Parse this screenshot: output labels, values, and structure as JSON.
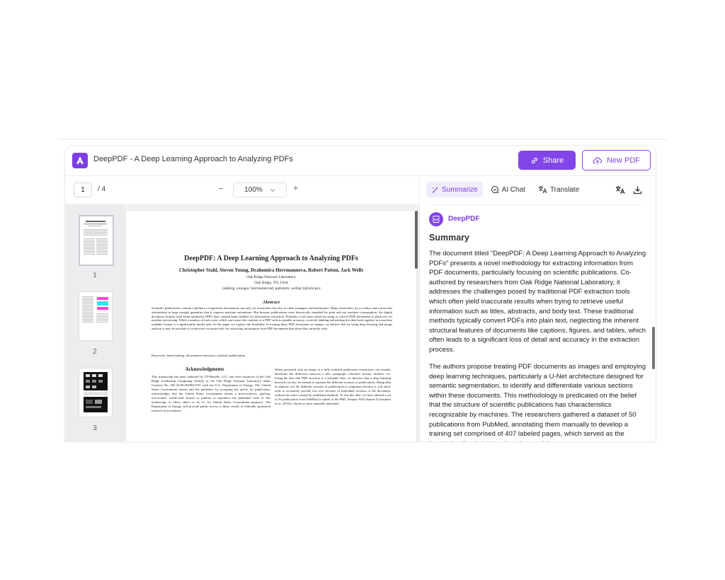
{
  "header": {
    "title": "DeepPDF - A Deep Learning Approach to Analyzing PDFs",
    "share_label": "Share",
    "new_pdf_label": "New PDF"
  },
  "viewer": {
    "current_page": "1",
    "total_pages": "/ 4",
    "zoom": "100%",
    "thumbnails": [
      "1",
      "2",
      "3"
    ]
  },
  "paper": {
    "title": "DeepPDF: A Deep Learning Approach to Analyzing PDFs",
    "authors": "Christopher Stahl, Steven Young, Drahomira Herrmannova, Robert Patton, Jack Wells",
    "affil1": "Oak Ridge National Laboratory",
    "affil2": "Oak Ridge, TN, USA",
    "emails": "{stahlcg, youngsr, herrmannovad, pattonrm, wellsjc}@ornl.gov",
    "abstract_heading": "Abstract",
    "abstract": "Scientific publications contain a plethora of important information, not only for researchers but also for their managers and institutions. Many researchers try to collect and extract this information in large enough quantities that it requires machine automation. But because publications were historically intended for print and not machine consumption, the digital document formats used today (primarily PDF) have created many hurdles for information extraction. Primarily, tools have relied on trying to convert PDF documents to plain text for machine processing. While a number of tools exist, which can extract the contents of a PDF with acceptable accuracy, correctly labeling and piecing this data back together in a machine readable format is a significantly harder task. In this paper we explore the feasibility of treating these PDF documents as images, we believe that by using deep learning and image analysis it may be possible to create more accurate tools for extracting information from PDF documents than those that currently exist.",
    "keywords": "Keywords: deep learning, information extraction, scholarly publications",
    "ack_heading": "Acknowledgments",
    "col1": "This manuscript has been authored by UT-Battelle, LLC and used resources of the Oak Ridge Leadership Computing Facility at the Oak Ridge National Laboratory under Contract No. DE-AC05-00OR22725 with the U.S. Department of Energy. The United States Government retains and the publisher, by accepting the article for publication, acknowledges that the United States Government retains a non-exclusive, paid-up, irrevocable, world-wide license to publish or reproduce the published form of this manuscript, or allow others to do so, for United States Government purposes. The Department of Energy will provide public access to these results of federally sponsored research in accordance",
    "col2": "When presented with an image of a fully redacted publication researchers can visually determine the difference between a title, paragraph, reference section, headers, etc. Using the idea that PDF structure is a trainable idea, we theorize that a deep learning network can also be trained to separate the different sections of publications. Being able to separate out the different sections of publications is important because it will allow tools to accurately provide raw text versions of individual sections of the document, without the noise created by traditional methods. To test this idea, we have utilized a set of 50 publications from PubMed (a subset of the PMC Sample 1943 dataset (Constantin et al., 2013)), which we have manually annotated"
  },
  "panel": {
    "tabs": [
      {
        "label": "Summarize",
        "icon": "sparkle-wand-icon",
        "active": true
      },
      {
        "label": "AI Chat",
        "icon": "chat-bubble-icon",
        "active": false
      },
      {
        "label": "Translate",
        "icon": "translate-icon",
        "active": false
      }
    ],
    "brand": "DeepPDF",
    "summary_heading": "Summary",
    "paragraph1": "The document titled “DeepPDF: A Deep Learning Approach to Analyzing PDFs” presents a novel methodology for extracting information from PDF documents, particularly focusing on scientific publications. Co-authored by researchers from Oak Ridge National Laboratory, it addresses the challenges posed by traditional PDF extraction tools which often yield inaccurate results when trying to retrieve useful information such as titles, abstracts, and body text. These traditional methods typically convert PDFs into plain text, neglecting the inherent structural features of documents like captions, figures, and tables, which often leads to a significant loss of detail and accuracy in the extraction process.",
    "paragraph2": "The authors propose treating PDF documents as images and employing deep learning techniques, particularly a U-Net architecture designed for semantic segmentation, to identify and differentiate various sections within these documents. This methodology is predicated on the belief that the structure of scientific publications has characteristics recognizable by machines. The researchers gathered a dataset of 50 publications from PubMed, annotating them manually to develop a training set comprised of 407 labeled pages, which served as the foundation for their deep learning model."
  },
  "colors": {
    "accent": "#8245e8",
    "accent_light": "#f1ecfd"
  }
}
